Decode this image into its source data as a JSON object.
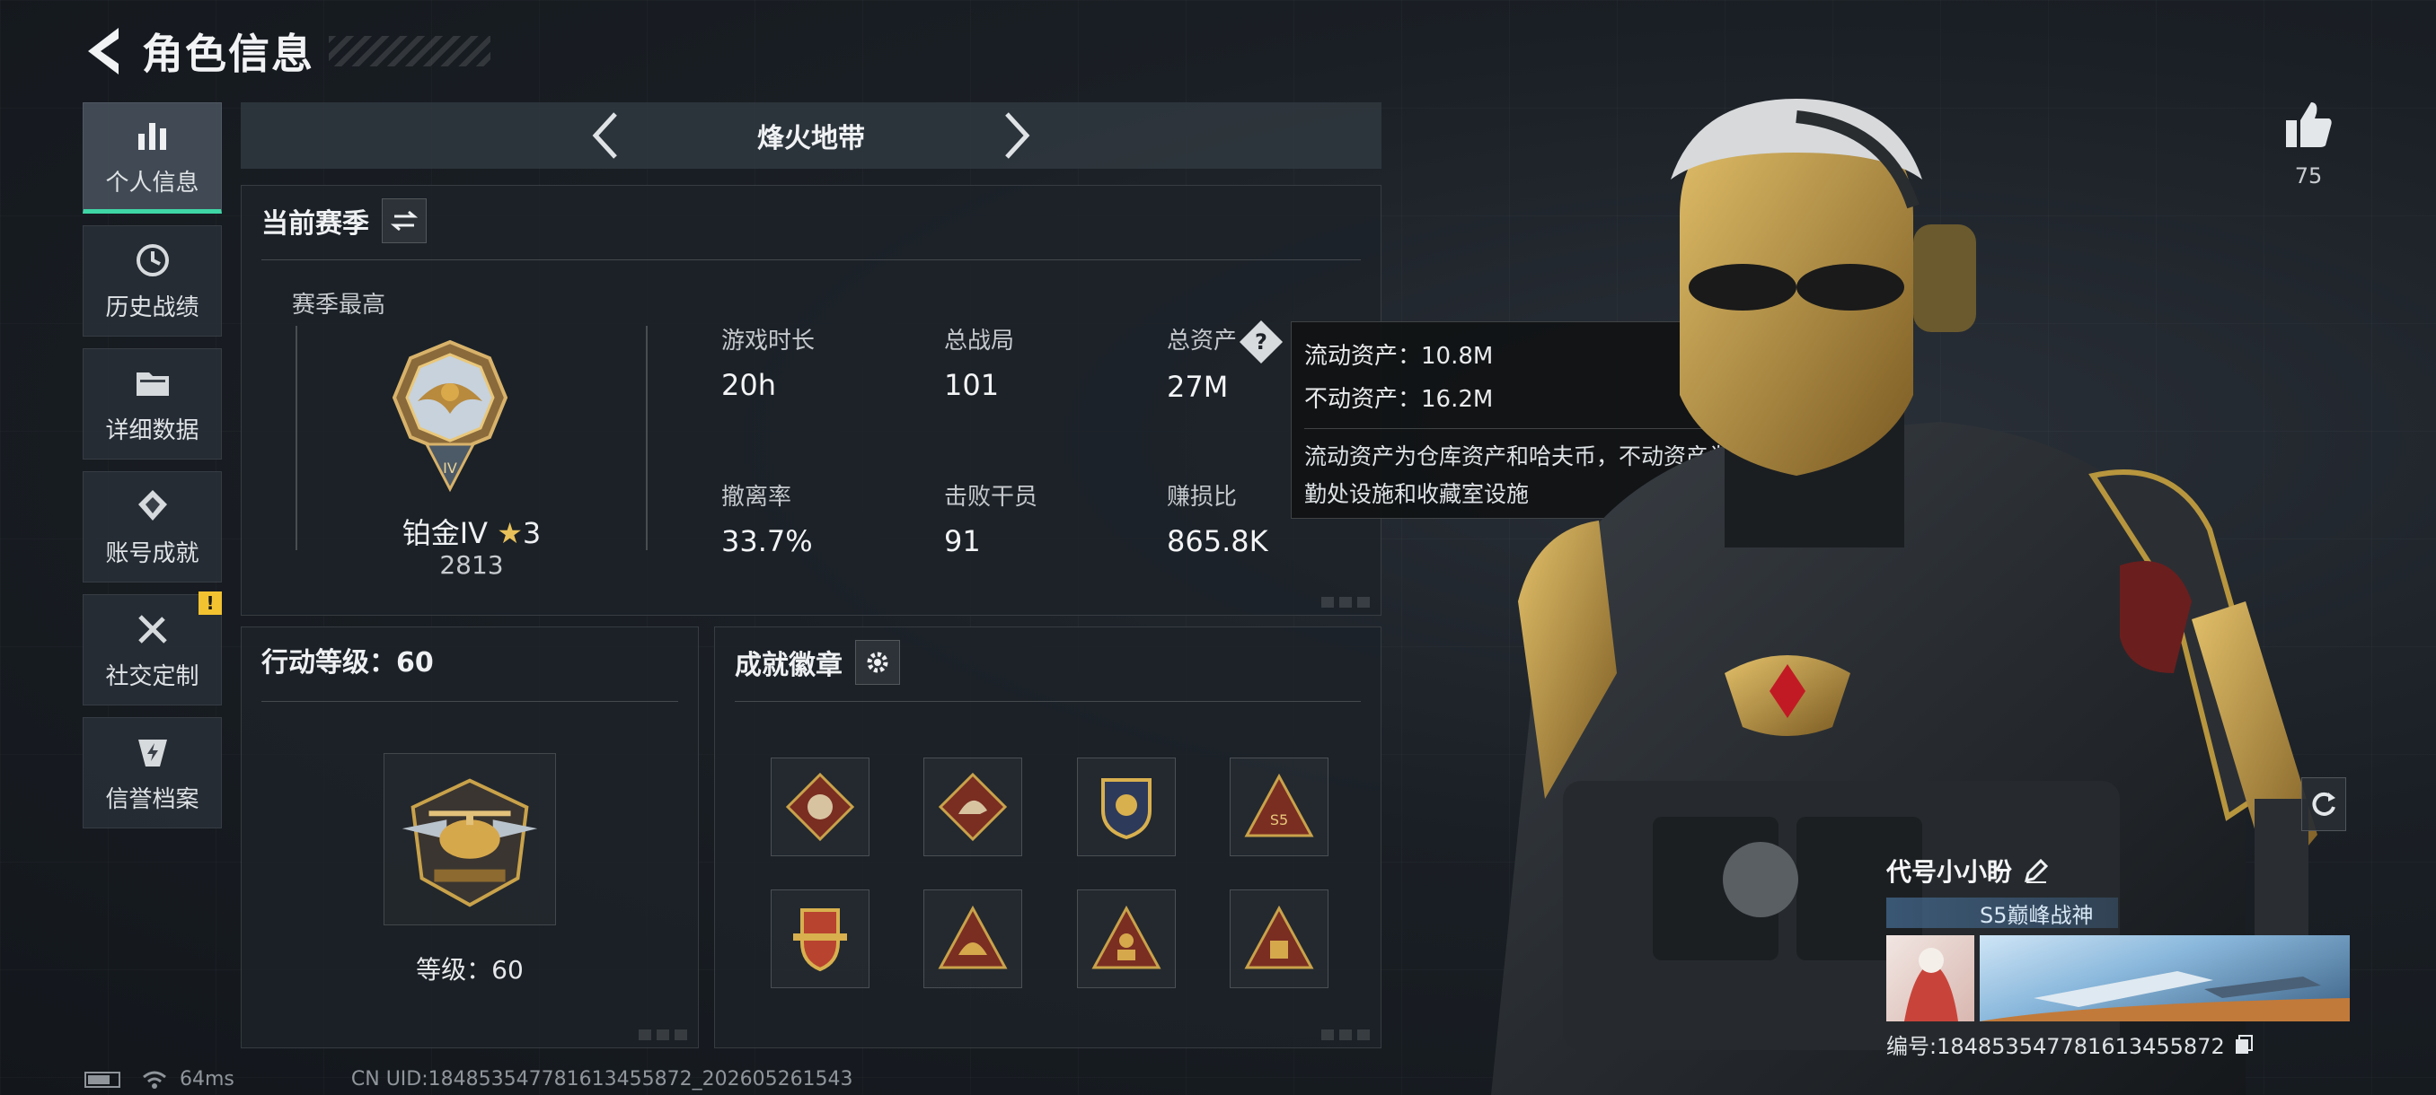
{
  "header": {
    "title": "角色信息"
  },
  "sidebar": {
    "items": [
      {
        "label": "个人信息",
        "icon": "bar-chart-icon",
        "active": true
      },
      {
        "label": "历史战绩",
        "icon": "history-icon"
      },
      {
        "label": "详细数据",
        "icon": "folder-icon"
      },
      {
        "label": "账号成就",
        "icon": "achievement-icon"
      },
      {
        "label": "社交定制",
        "icon": "tools-icon",
        "badge": "!"
      },
      {
        "label": "信誉档案",
        "icon": "credit-shield-icon"
      }
    ]
  },
  "mode": {
    "title": "烽火地带"
  },
  "season_panel": {
    "title": "当前赛季",
    "best_label": "赛季最高",
    "rank_name": "铂金IV",
    "rank_stars": "3",
    "rank_score": "2813",
    "stats": [
      {
        "label": "游戏时长",
        "value": "20h"
      },
      {
        "label": "总战局",
        "value": "101"
      },
      {
        "label": "总资产",
        "value": "27M"
      },
      {
        "label": "撤离率",
        "value": "33.7%"
      },
      {
        "label": "击败干员",
        "value": "91"
      },
      {
        "label": "赚损比",
        "value": "865.8K"
      }
    ]
  },
  "tooltip": {
    "liquid": "流动资产：10.8M",
    "fixed": "不动资产：16.2M",
    "desc": "流动资产为仓库资产和哈夫币，不动资产为特勤处设施和收藏室设施"
  },
  "action_panel": {
    "title": "行动等级：60",
    "level_label": "等级：60"
  },
  "achievement_panel": {
    "title": "成就徽章"
  },
  "like": {
    "count": "75"
  },
  "profile_card": {
    "name": "代号小小盼",
    "title_badge": "S5巅峰战神",
    "id": "编号:1848535477816134558​72"
  },
  "footer": {
    "ping": "64ms",
    "uid": "CN UID:1848535477816134558​72_202605261543"
  },
  "colors": {
    "accent": "#3fd6a6",
    "badge": "#f2c230",
    "gold": "#c9a24a"
  }
}
